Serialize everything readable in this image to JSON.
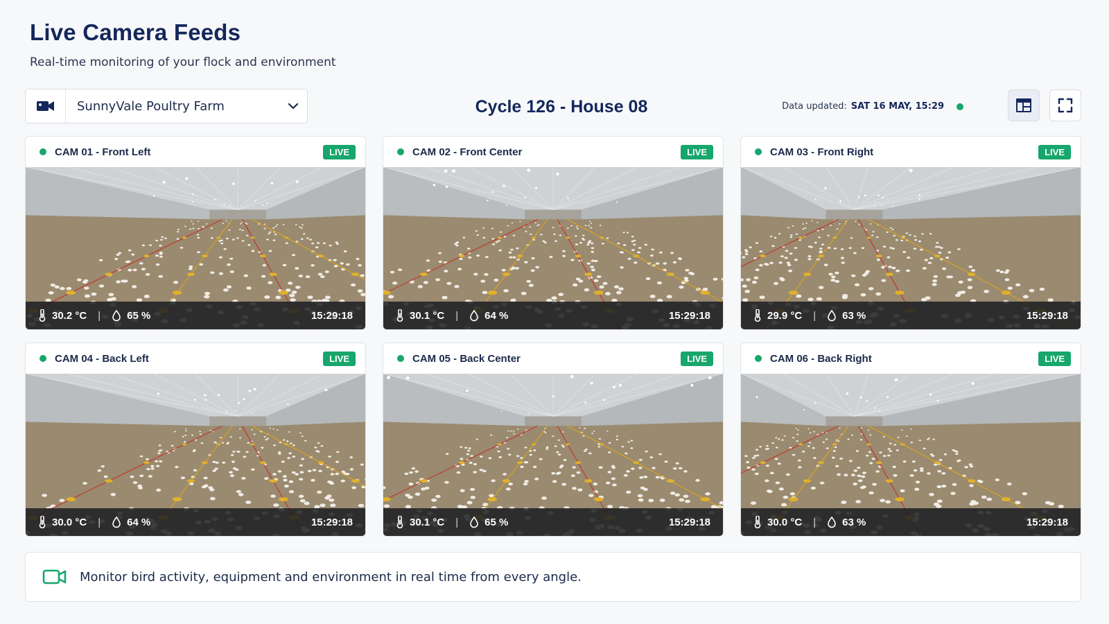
{
  "header": {
    "title": "Live Camera Feeds",
    "subtitle": "Real-time monitoring of your flock and environment"
  },
  "farm_selector": {
    "icon": "video-camera-icon",
    "value": "SunnyVale Poultry Farm",
    "chevron": "chevron-down-icon"
  },
  "cycle_title": "Cycle 126 - House 08",
  "updated": {
    "label": "Data updated:",
    "value": "SAT 16 MAY, 15:29",
    "status_color": "#17a66b"
  },
  "toolbar": {
    "layout_icon": "grid-layout-icon",
    "fullscreen_icon": "fullscreen-icon"
  },
  "colors": {
    "accent": "#17a66b",
    "navy": "#14275a",
    "overlay": "#1c1e22"
  },
  "cameras": [
    {
      "name": "CAM 01 - Front Left",
      "badge": "LIVE",
      "temp": "30.2 °C",
      "humidity": "65 %",
      "time": "15:29:18"
    },
    {
      "name": "CAM 02 - Front Center",
      "badge": "LIVE",
      "temp": "30.1 °C",
      "humidity": "64 %",
      "time": "15:29:18"
    },
    {
      "name": "CAM 03 - Front Right",
      "badge": "LIVE",
      "temp": "29.9 °C",
      "humidity": "63 %",
      "time": "15:29:18"
    },
    {
      "name": "CAM 04 - Back Left",
      "badge": "LIVE",
      "temp": "30.0 °C",
      "humidity": "64 %",
      "time": "15:29:18"
    },
    {
      "name": "CAM 05 - Back Center",
      "badge": "LIVE",
      "temp": "30.1 °C",
      "humidity": "65 %",
      "time": "15:29:18"
    },
    {
      "name": "CAM 06 - Back Right",
      "badge": "LIVE",
      "temp": "30.0 °C",
      "humidity": "63 %",
      "time": "15:29:18"
    }
  ],
  "footer": {
    "icon": "video-camera-icon",
    "text": "Monitor bird activity, equipment and environment in real time from every angle."
  }
}
